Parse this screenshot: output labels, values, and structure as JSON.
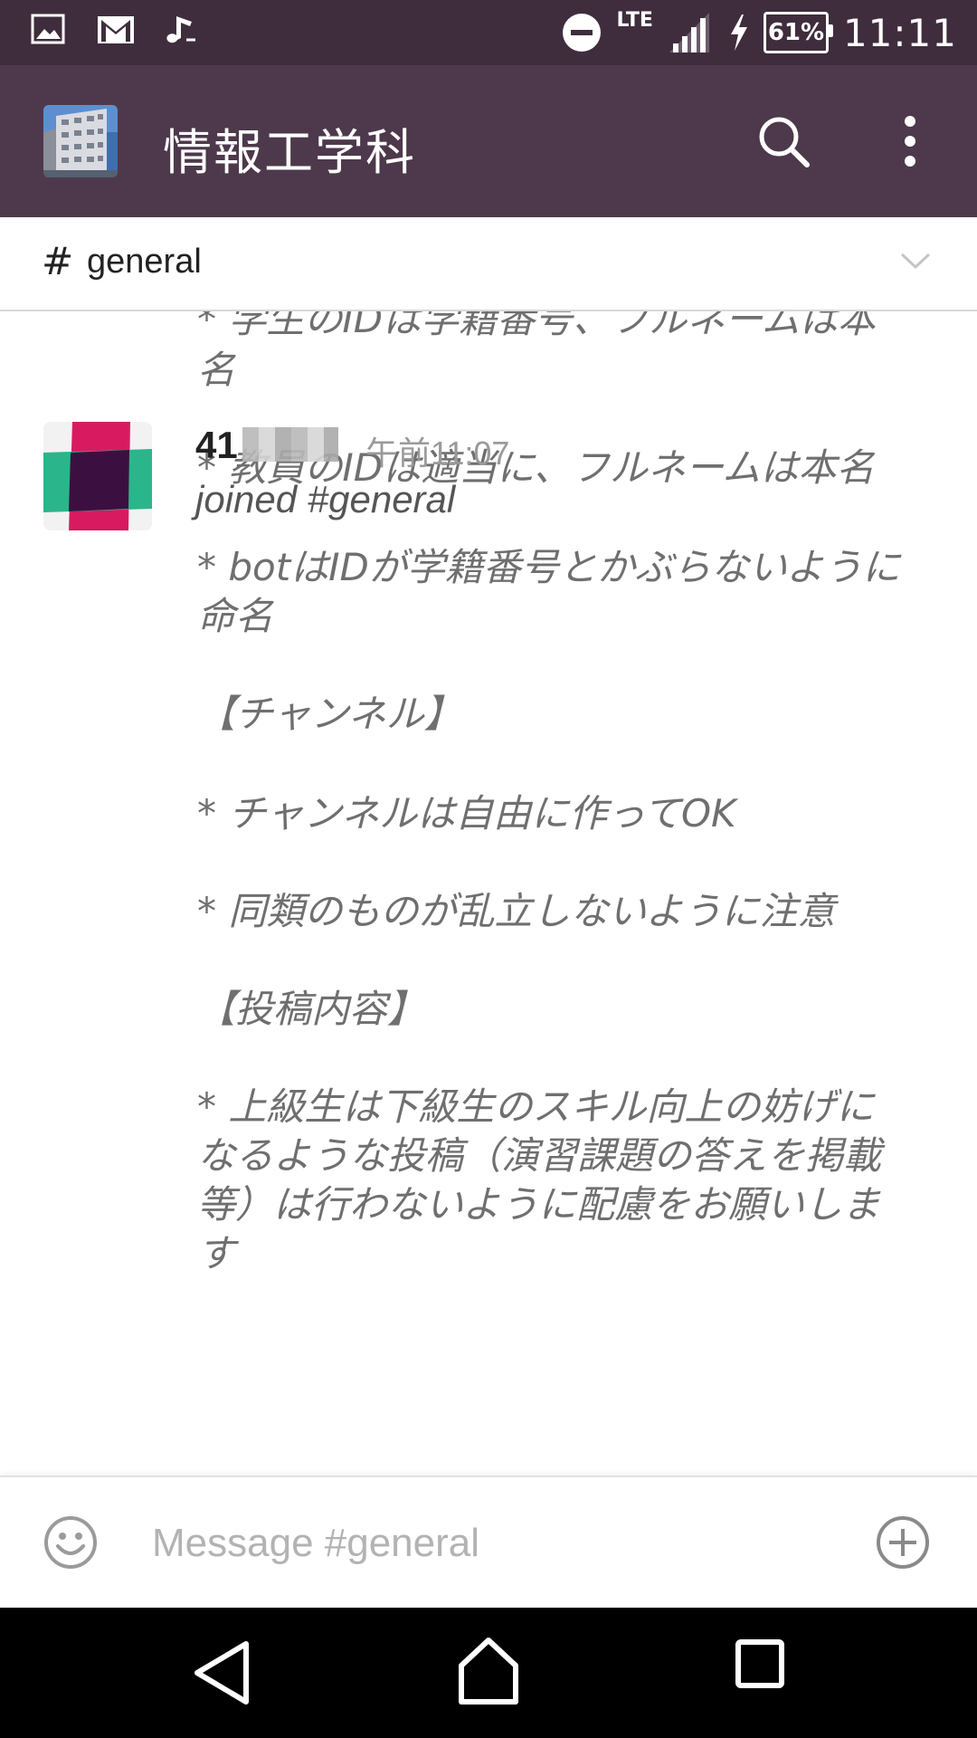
{
  "status_bar": {
    "network": "LTE",
    "battery": "61%",
    "time": "11:11",
    "icons": [
      "gallery-icon",
      "gmail-icon",
      "music-note-icon",
      "do-not-disturb-icon",
      "signal-icon",
      "charging-icon",
      "battery-icon"
    ]
  },
  "app_bar": {
    "team_name": "情報工学科",
    "icons": [
      "search-icon",
      "more-vert-icon"
    ]
  },
  "channel": {
    "hash": "#",
    "name": "general"
  },
  "message_body": {
    "lines": [
      "* 学生のIDは学籍番号、フルネームは本",
      "名",
      "* 教員のIDは適当に、フルネームは本名",
      "* botはIDが学籍番号とかぶらないように",
      "命名",
      "【チャンネル】",
      "* チャンネルは自由に作ってOK",
      "* 同類のものが乱立しないように注意",
      "【投稿内容】",
      "* 上級生は下級生のスキル向上の妨げに",
      "なるような投稿（演習課題の答えを掲載",
      "等）は行わないように配慮をお願いしま",
      "す"
    ]
  },
  "join_message": {
    "username_visible": "41",
    "time": "午前11:07",
    "text": "joined #general"
  },
  "composer": {
    "placeholder": "Message #general",
    "icons": [
      "emoji-icon",
      "add-icon"
    ]
  },
  "nav_bar": {
    "icons": [
      "back-icon",
      "home-icon",
      "recents-icon"
    ]
  },
  "colors": {
    "status_bar": "#3f2d3d",
    "app_bar": "#4d394b",
    "message_text": "#777777",
    "placeholder": "#b3b3b3"
  }
}
